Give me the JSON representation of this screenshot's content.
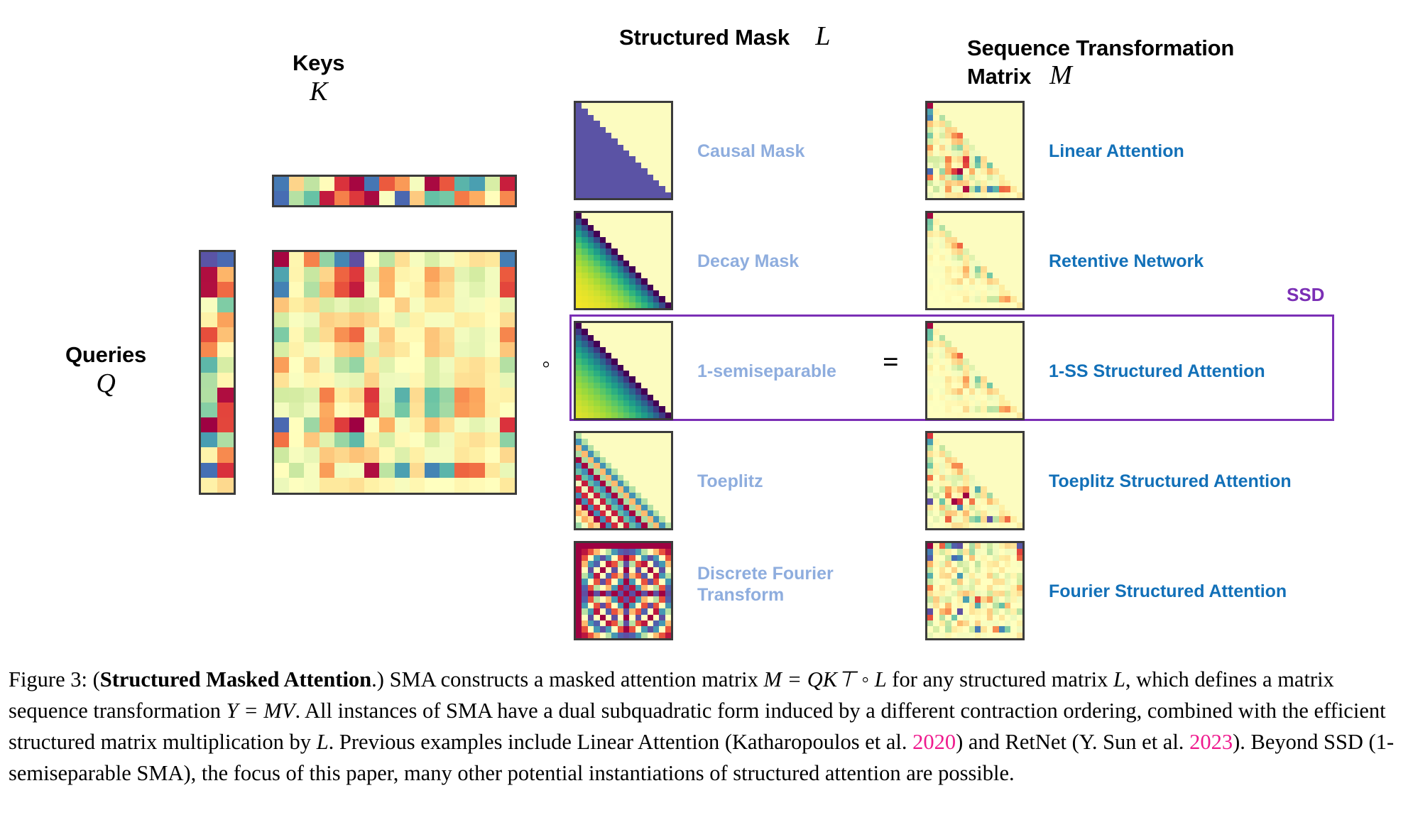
{
  "figure": {
    "headers": [
      {
        "id": "keys",
        "text": "Keys",
        "sym": "K"
      },
      {
        "id": "queries",
        "text": "Queries",
        "sym": "Q"
      },
      {
        "id": "structured_mask",
        "text": "Structured Mask",
        "sym": "L"
      },
      {
        "id": "seq_transform",
        "text": "Sequence Transformation\nMatrix",
        "sym": "M"
      }
    ],
    "operators": {
      "hadamard": "◦",
      "equals": "="
    },
    "ssd_label": "SSD",
    "rows": [
      {
        "mask_label": "Causal Mask",
        "attention_label": "Linear Attention",
        "mask_type": "causal",
        "in_ssd": false
      },
      {
        "mask_label": "Decay Mask",
        "attention_label": "Retentive Network",
        "mask_type": "decay",
        "in_ssd": false
      },
      {
        "mask_label": "1-semiseparable",
        "attention_label": "1-SS Structured Attention",
        "mask_type": "semiseparable",
        "in_ssd": true
      },
      {
        "mask_label": "Toeplitz",
        "attention_label": "Toeplitz Structured Attention",
        "mask_type": "toeplitz",
        "in_ssd": false
      },
      {
        "mask_label": "Discrete Fourier\nTransform",
        "attention_label": "Fourier Structured Attention",
        "mask_type": "dft",
        "in_ssd": false
      }
    ],
    "colors": {
      "mask_label": "#8eadde",
      "attention_label": "#1270b8",
      "ssd_purple": "#7b2fb5",
      "citation_magenta": "#ef1a8e",
      "matrix_border": "#3b3b3b",
      "mask_light": "#fcfcc0",
      "mask_dark": "#5b53a5"
    }
  },
  "caption": {
    "prefix": "Figure 3: (",
    "bold_title": "Structured Masked Attention",
    "after_title": ".) SMA constructs a masked attention matrix ",
    "eq1": "M = QK⊤ ◦ L",
    "t1": " for any structured matrix ",
    "eq2": "L",
    "t2": ", which defines a matrix sequence transformation ",
    "eq3": "Y = MV",
    "t3": ". All instances of SMA have a dual subquadratic form induced by a different contraction ordering, combined with the efficient structured matrix multiplication by ",
    "eq4": "L",
    "t4": ". Previous examples include Linear Attention (Katharopoulos et al. ",
    "cite1": "2020",
    "t5": ") and RetNet (Y. Sun et al. ",
    "cite2": "2023",
    "t6": "). Beyond SSD (1-semiseparable SMA), the focus of this paper, many other potential instantiations of structured attention are possible."
  },
  "chart_data": {
    "type": "heatmap",
    "title": "Structured Masked Attention",
    "colormap_qk": "Spectral",
    "colormap_mask_binary": [
      "#fcfcc0",
      "#5b53a5"
    ],
    "matrices": {
      "Q": {
        "rows": 16,
        "cols": 2,
        "label": "Queries Q"
      },
      "K": {
        "rows": 2,
        "cols": 16,
        "label": "Keys K"
      },
      "QK": {
        "rows": 16,
        "cols": 16,
        "label": "QK transpose"
      },
      "L_causal": {
        "rows": 16,
        "cols": 16,
        "label": "Causal Mask"
      },
      "L_decay": {
        "rows": 16,
        "cols": 16,
        "label": "Decay Mask"
      },
      "L_1ss": {
        "rows": 16,
        "cols": 16,
        "label": "1-semiseparable"
      },
      "L_toeplitz": {
        "rows": 16,
        "cols": 16,
        "label": "Toeplitz"
      },
      "L_dft": {
        "rows": 16,
        "cols": 16,
        "label": "Discrete Fourier Transform"
      },
      "M_linear": {
        "rows": 16,
        "cols": 16,
        "label": "Linear Attention"
      },
      "M_retnet": {
        "rows": 16,
        "cols": 16,
        "label": "Retentive Network"
      },
      "M_1ss": {
        "rows": 16,
        "cols": 16,
        "label": "1-SS Structured Attention"
      },
      "M_toeplitz": {
        "rows": 16,
        "cols": 16,
        "label": "Toeplitz Structured Attention"
      },
      "M_fourier": {
        "rows": 16,
        "cols": 16,
        "label": "Fourier Structured Attention"
      }
    }
  }
}
